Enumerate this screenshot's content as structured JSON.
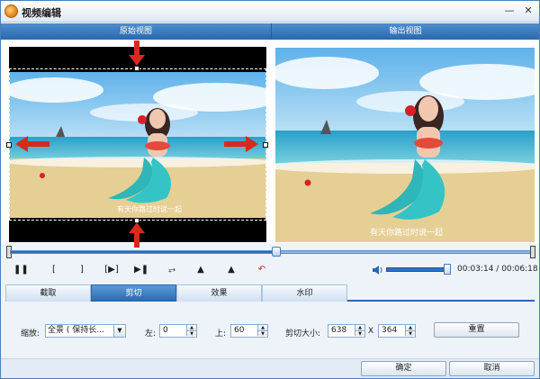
{
  "window": {
    "title": "视频编辑"
  },
  "views": {
    "original": "原始视图",
    "output": "输出视图"
  },
  "subtitle": "有天你路过时说一起",
  "playback": {
    "current": "00:03:14",
    "total": "00:06:18",
    "separator": " / ",
    "progress": 0.51,
    "volume": 1.0
  },
  "tabs": [
    {
      "label": "截取",
      "active": false
    },
    {
      "label": "剪切",
      "active": true
    },
    {
      "label": "效果",
      "active": false
    },
    {
      "label": "水印",
      "active": false
    }
  ],
  "crop": {
    "zoom_label": "缩放:",
    "zoom_value": "全景 ( 保持长...",
    "left_label": "左:",
    "left_value": "0",
    "top_label": "上:",
    "top_value": "60",
    "size_label": "剪切大小:",
    "width_value": "638",
    "x_label": "X",
    "height_value": "364",
    "reset_label": "重置"
  },
  "footer": {
    "ok_label": "确定",
    "cancel_label": "取消"
  },
  "colors": {
    "accent": "#2a68ae",
    "arrow": "#d62a1e"
  }
}
